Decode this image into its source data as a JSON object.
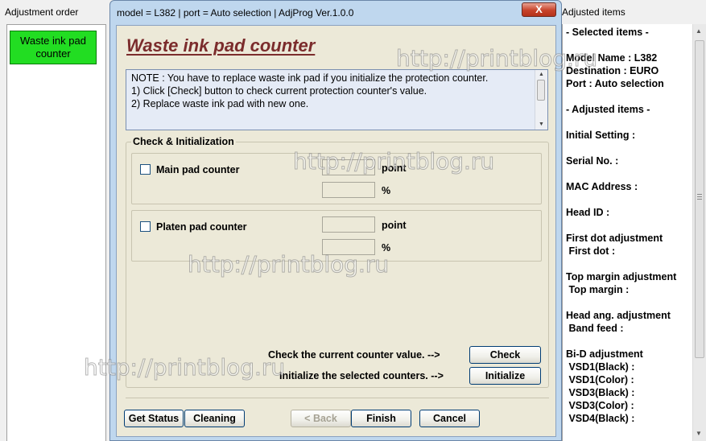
{
  "left_panel": {
    "title": "Adjustment order",
    "items": [
      {
        "label": "Waste ink pad\ncounter",
        "color": "#22dd22"
      }
    ]
  },
  "right_panel": {
    "title": "Adjusted items",
    "content": "- Selected items -\n\nModel Name : L382\nDestination : EURO\nPort : Auto selection\n\n- Adjusted items -\n\nInitial Setting :\n\nSerial No. :\n\nMAC Address :\n\nHead ID :\n\nFirst dot adjustment\n First dot :\n\nTop margin adjustment\n Top margin :\n\nHead ang. adjustment\n Band feed :\n\nBi-D adjustment\n VSD1(Black) :\n VSD1(Color) :\n VSD3(Black) :\n VSD3(Color) :\n VSD4(Black) :"
  },
  "dialog": {
    "title": "model = L382 | port = Auto selection | AdjProg Ver.1.0.0",
    "close_label": "X",
    "heading": "Waste ink pad counter",
    "note": "NOTE : You have to replace waste ink pad if you initialize the protection counter.\n1) Click [Check] button to check current protection counter's value.\n2) Replace waste ink pad with new one.",
    "check_group": {
      "legend": "Check & Initialization",
      "main_pad": {
        "label": "Main pad counter",
        "checked": false,
        "point_value": "",
        "percent_value": ""
      },
      "platen_pad": {
        "label": "Platen pad counter",
        "checked": false,
        "point_value": "",
        "percent_value": ""
      },
      "unit_point": "point",
      "unit_percent": "%"
    },
    "check_instruction": "Check the current counter value. -->",
    "check_button": "Check",
    "init_instruction": "Initialize the selected counters. -->",
    "init_button": "Initialize",
    "buttons": {
      "get_status": "Get Status",
      "cleaning": "Cleaning",
      "back": "< Back",
      "finish": "Finish",
      "cancel": "Cancel"
    }
  },
  "watermark": "http://printblog.ru",
  "colors": {
    "heading": "#7b2c2c",
    "highlight_item": "#22dd22",
    "dialog_frame": "#bfd7ee",
    "client_bg": "#ece9d8"
  }
}
